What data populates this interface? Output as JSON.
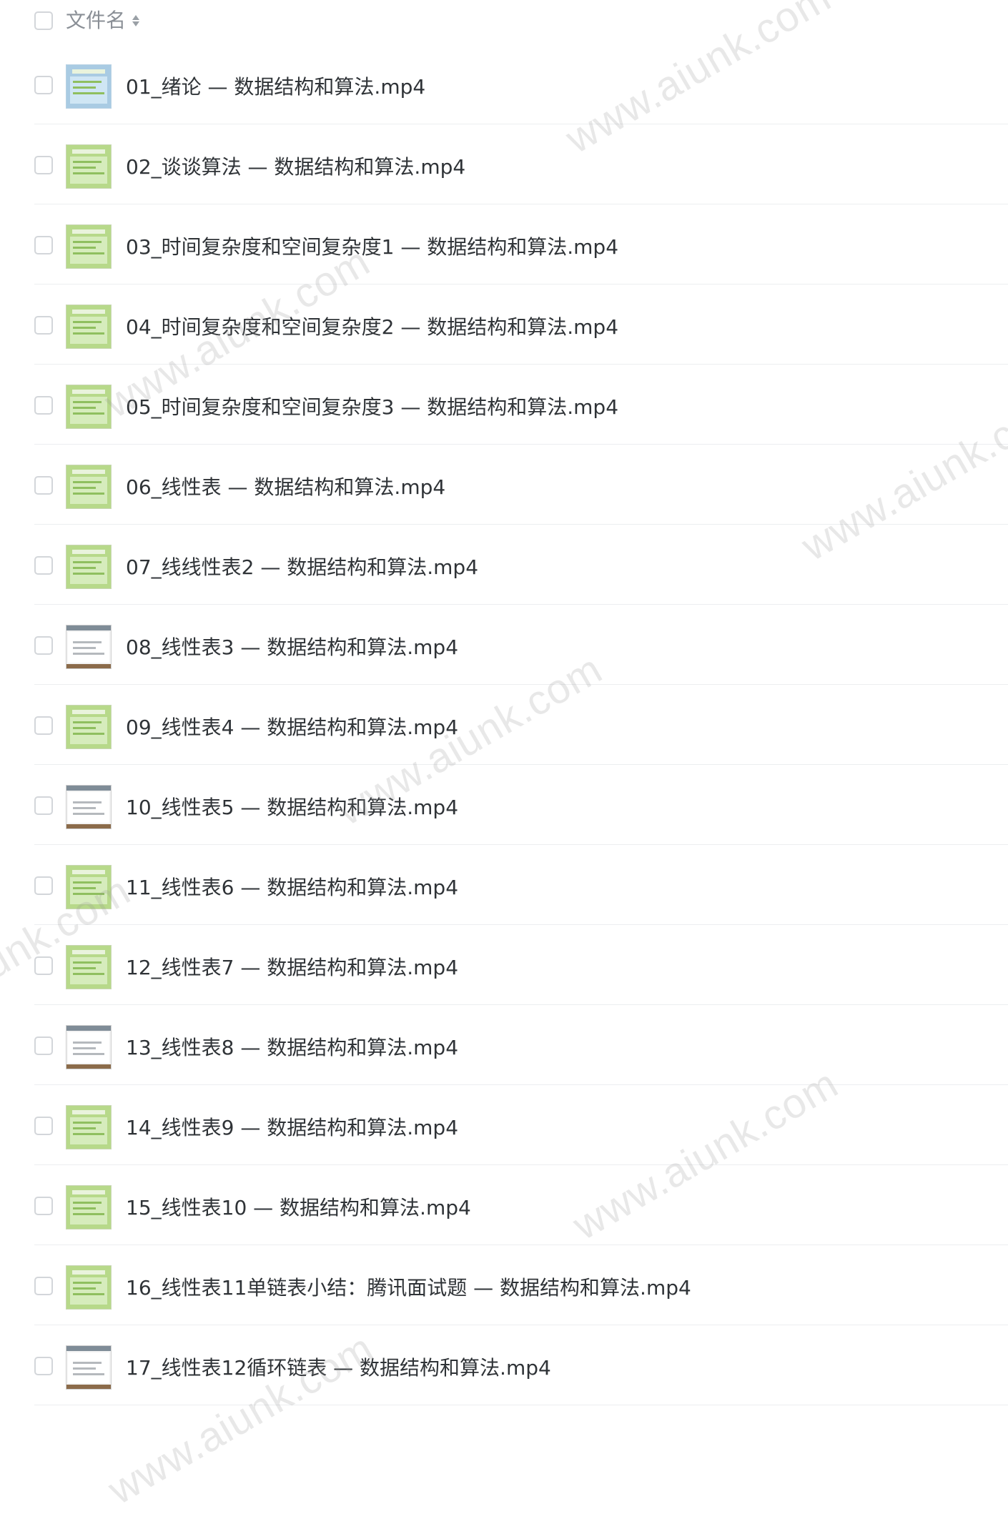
{
  "header": {
    "column_label": "文件名",
    "sort_icon": "sort-icon"
  },
  "files": [
    {
      "name": "01_绪论 — 数据结构和算法.mp4",
      "thumbnail": "blue"
    },
    {
      "name": "02_谈谈算法 — 数据结构和算法.mp4",
      "thumbnail": "green"
    },
    {
      "name": "03_时间复杂度和空间复杂度1 — 数据结构和算法.mp4",
      "thumbnail": "green"
    },
    {
      "name": "04_时间复杂度和空间复杂度2 — 数据结构和算法.mp4",
      "thumbnail": "green"
    },
    {
      "name": "05_时间复杂度和空间复杂度3 — 数据结构和算法.mp4",
      "thumbnail": "green"
    },
    {
      "name": "06_线性表 — 数据结构和算法.mp4",
      "thumbnail": "green"
    },
    {
      "name": "07_线线性表2 — 数据结构和算法.mp4",
      "thumbnail": "green"
    },
    {
      "name": "08_线性表3 — 数据结构和算法.mp4",
      "thumbnail": "screen"
    },
    {
      "name": "09_线性表4 — 数据结构和算法.mp4",
      "thumbnail": "green"
    },
    {
      "name": "10_线性表5 — 数据结构和算法.mp4",
      "thumbnail": "screen"
    },
    {
      "name": "11_线性表6 — 数据结构和算法.mp4",
      "thumbnail": "green"
    },
    {
      "name": "12_线性表7 — 数据结构和算法.mp4",
      "thumbnail": "green"
    },
    {
      "name": "13_线性表8 — 数据结构和算法.mp4",
      "thumbnail": "screen"
    },
    {
      "name": "14_线性表9 — 数据结构和算法.mp4",
      "thumbnail": "green"
    },
    {
      "name": "15_线性表10 — 数据结构和算法.mp4",
      "thumbnail": "green"
    },
    {
      "name": "16_线性表11单链表小结：腾讯面试题 — 数据结构和算法.mp4",
      "thumbnail": "green"
    },
    {
      "name": "17_线性表12循环链表 — 数据结构和算法.mp4",
      "thumbnail": "screen"
    }
  ],
  "watermark": {
    "text": "www.aiunk.com"
  }
}
